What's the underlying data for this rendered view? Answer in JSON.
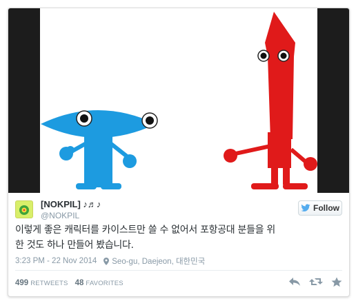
{
  "tweet": {
    "author": {
      "display_name": "[NOKPIL] ♪♬♪",
      "handle": "@NOKPIL"
    },
    "follow_label": "Follow",
    "text_line1": "이렇게 좋은 캐릭터를 카이스트만 쓸 수 없어서 포항공대 분들을 위",
    "text_line2": "한 것도 하나 만들어 봤습니다.",
    "timestamp": "3:23 PM - 22 Nov 2014",
    "location": "Seo-gu, Daejeon, 대한민국",
    "retweets_count": "499",
    "retweets_label": "RETWEETS",
    "favorites_count": "48",
    "favorites_label": "FAVORITES"
  },
  "media": {
    "description_colors": {
      "blue": "#1d9be0",
      "red": "#e01a1a",
      "letterbox": "#1c1c1c"
    }
  },
  "icons": [
    "bird-icon",
    "location-pin-icon",
    "reply-icon",
    "retweet-icon",
    "favorite-star-icon"
  ],
  "colors": {
    "accent": "#55acee",
    "text": "#292f33",
    "muted": "#8899a6"
  }
}
